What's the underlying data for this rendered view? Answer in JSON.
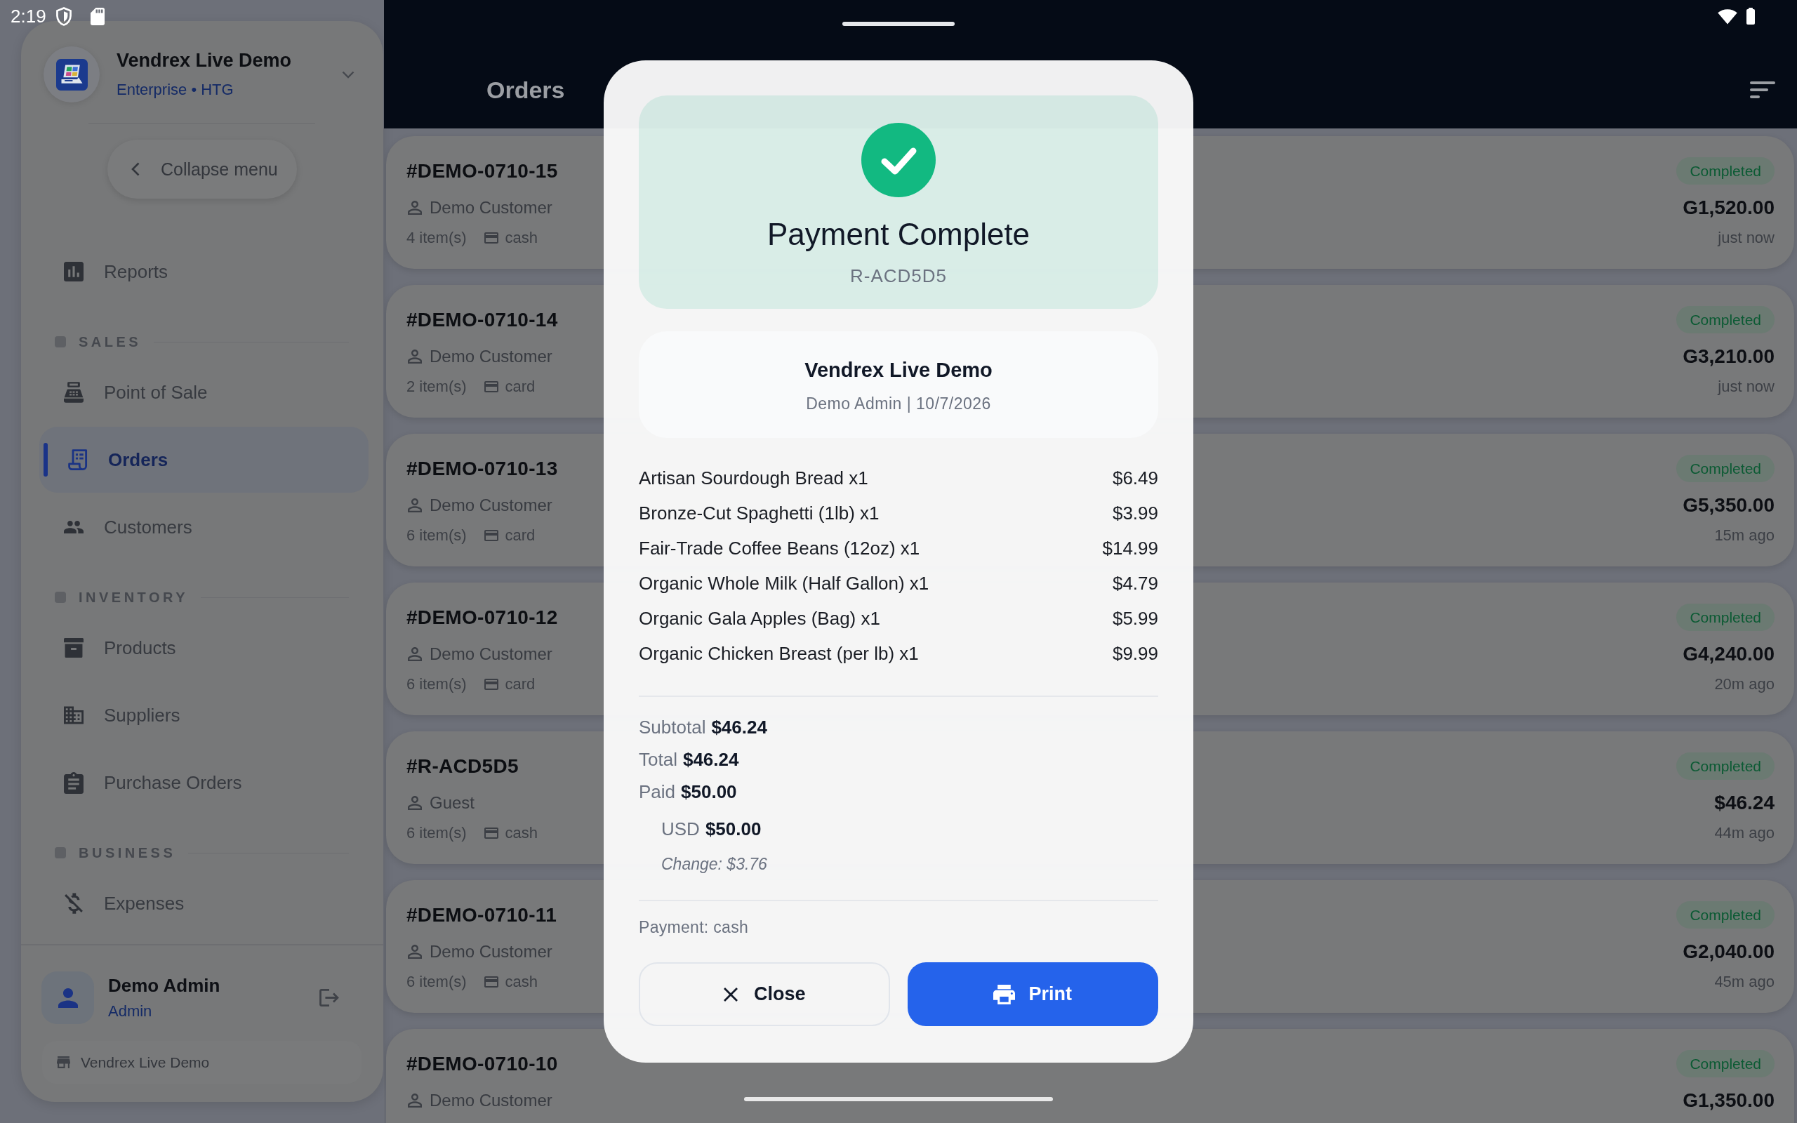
{
  "status_bar": {
    "time": "2:19"
  },
  "sidebar": {
    "store_name": "Vendrex Live Demo",
    "plan": "Enterprise • HTG",
    "collapse_button": "Collapse menu",
    "groups": [
      {
        "items": [
          {
            "label": "Reports",
            "selected": false
          }
        ]
      },
      {
        "title": "SALES",
        "items": [
          {
            "label": "Point of Sale",
            "selected": false
          },
          {
            "label": "Orders",
            "selected": true
          },
          {
            "label": "Customers",
            "selected": false
          }
        ]
      },
      {
        "title": "INVENTORY",
        "items": [
          {
            "label": "Products",
            "selected": false
          },
          {
            "label": "Suppliers",
            "selected": false
          },
          {
            "label": "Purchase Orders",
            "selected": false
          }
        ]
      },
      {
        "title": "BUSINESS",
        "items": [
          {
            "label": "Expenses",
            "selected": false
          }
        ]
      }
    ],
    "user": {
      "name": "Demo Admin",
      "role": "Admin"
    },
    "footer_store": "Vendrex Live Demo"
  },
  "header": {
    "title": "Orders"
  },
  "orders": [
    {
      "number": "#DEMO-0710-15",
      "customer": "Demo Customer",
      "items": "4 item(s)",
      "payment": "cash",
      "status": "Completed",
      "total": "G1,520.00",
      "time": "just now"
    },
    {
      "number": "#DEMO-0710-14",
      "customer": "Demo Customer",
      "items": "2 item(s)",
      "payment": "card",
      "status": "Completed",
      "total": "G3,210.00",
      "time": "just now"
    },
    {
      "number": "#DEMO-0710-13",
      "customer": "Demo Customer",
      "items": "6 item(s)",
      "payment": "card",
      "status": "Completed",
      "total": "G5,350.00",
      "time": "15m ago"
    },
    {
      "number": "#DEMO-0710-12",
      "customer": "Demo Customer",
      "items": "6 item(s)",
      "payment": "card",
      "status": "Completed",
      "total": "G4,240.00",
      "time": "20m ago"
    },
    {
      "number": "#R-ACD5D5",
      "customer": "Guest",
      "items": "6 item(s)",
      "payment": "cash",
      "status": "Completed",
      "total": "$46.24",
      "time": "44m ago"
    },
    {
      "number": "#DEMO-0710-11",
      "customer": "Demo Customer",
      "items": "6 item(s)",
      "payment": "cash",
      "status": "Completed",
      "total": "G2,040.00",
      "time": "45m ago"
    },
    {
      "number": "#DEMO-0710-10",
      "customer": "Demo Customer",
      "status": "Completed",
      "total": "G1,350.00"
    }
  ],
  "payment_dialog": {
    "title": "Payment Complete",
    "receipt_number": "R-ACD5D5",
    "store_name": "Vendrex Live Demo",
    "cashier_date": "Demo Admin | 10/7/2026",
    "line_items": [
      {
        "name": "Artisan Sourdough Bread x1",
        "price": "$6.49"
      },
      {
        "name": "Bronze-Cut Spaghetti (1lb) x1",
        "price": "$3.99"
      },
      {
        "name": "Fair-Trade Coffee Beans (12oz) x1",
        "price": "$14.99"
      },
      {
        "name": "Organic Whole Milk (Half Gallon) x1",
        "price": "$4.79"
      },
      {
        "name": "Organic Gala Apples (Bag) x1",
        "price": "$5.99"
      },
      {
        "name": "Organic Chicken Breast (per lb) x1",
        "price": "$9.99"
      }
    ],
    "totals": [
      {
        "label": "Subtotal",
        "value": "$46.24"
      },
      {
        "label": "Total",
        "value": "$46.24"
      },
      {
        "label": "Paid",
        "value": "$50.00"
      }
    ],
    "tenders": [
      {
        "currency": "USD",
        "amount": "$50.00"
      }
    ],
    "change": "Change: $3.76",
    "payment_method": "Payment: cash",
    "buttons": [
      {
        "label": "Close",
        "kind": "secondary"
      },
      {
        "label": "Print",
        "kind": "primary"
      }
    ]
  }
}
